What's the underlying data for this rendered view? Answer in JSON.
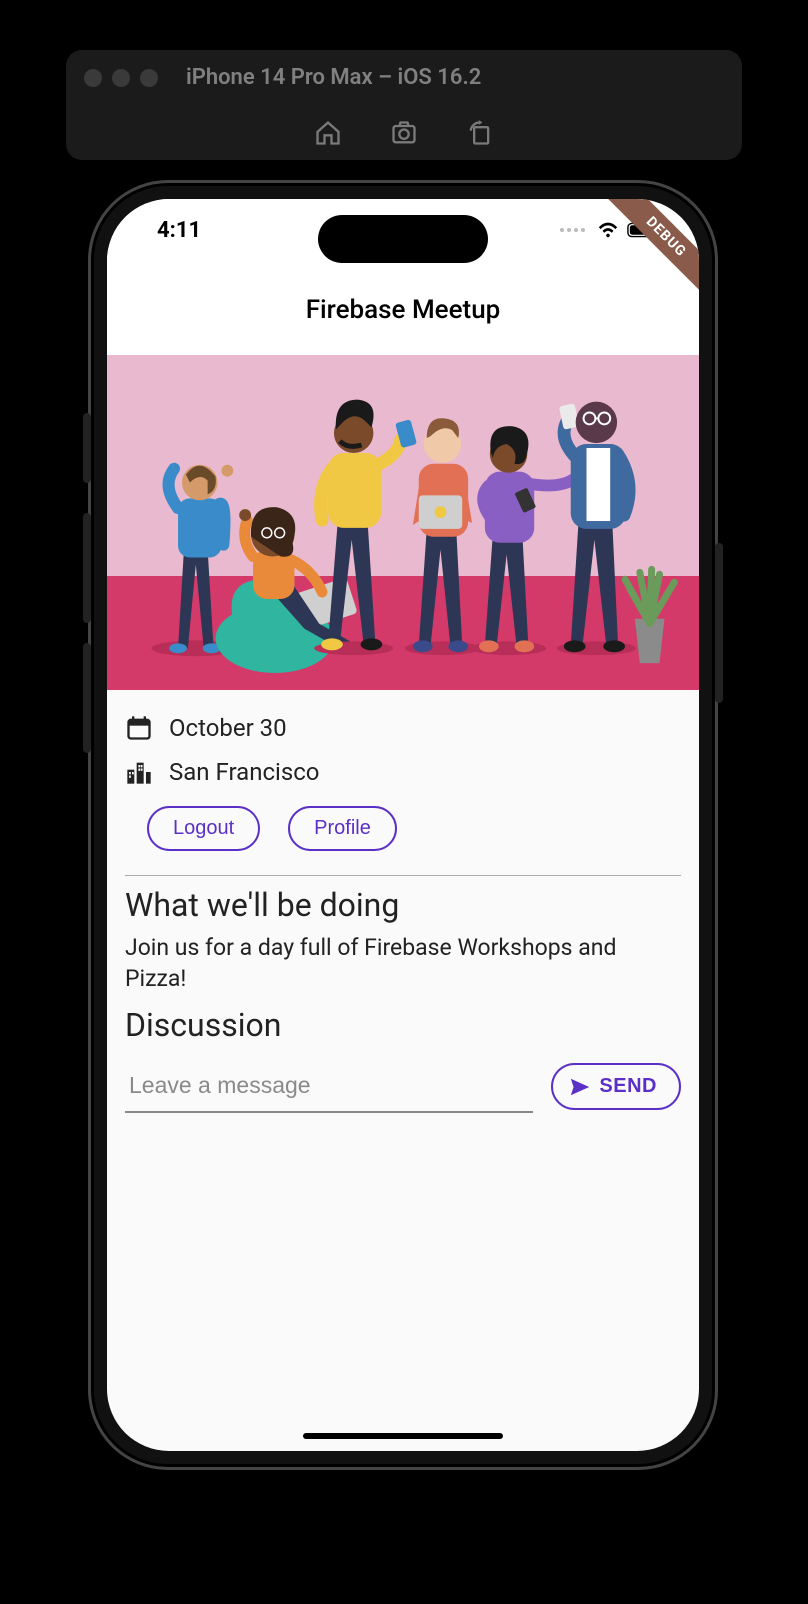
{
  "simulator": {
    "title": "iPhone 14 Pro Max – iOS 16.2"
  },
  "status": {
    "time": "4:11"
  },
  "debug_label": "DEBUG",
  "app": {
    "title": "Firebase Meetup",
    "date": "October 30",
    "city": "San Francisco",
    "buttons": {
      "logout": "Logout",
      "profile": "Profile"
    },
    "section": {
      "heading": "What we'll be doing",
      "body": "Join us for a day full of Firebase Workshops and Pizza!"
    },
    "discussion": {
      "heading": "Discussion",
      "placeholder": "Leave a message",
      "send": "SEND"
    }
  }
}
